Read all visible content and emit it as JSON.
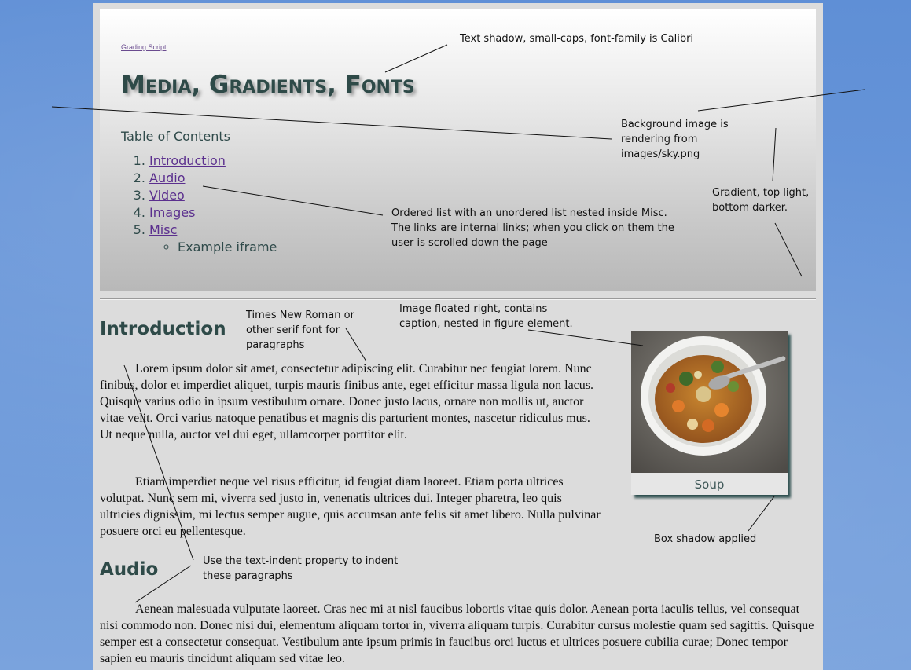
{
  "header": {
    "grading_link": "Grading Script",
    "title": "Media, Gradients, Fonts",
    "toc_title": "Table of Contents",
    "toc": [
      {
        "label": "Introduction"
      },
      {
        "label": "Audio"
      },
      {
        "label": "Video"
      },
      {
        "label": "Images"
      },
      {
        "label": "Misc"
      }
    ],
    "toc_sub": [
      "Example iframe"
    ]
  },
  "sections": {
    "intro": {
      "heading": "Introduction",
      "p1": "Lorem ipsum dolor sit amet, consectetur adipiscing elit. Curabitur nec feugiat lorem. Nunc finibus, dolor et imperdiet aliquet, turpis mauris finibus ante, eget efficitur massa ligula non lacus. Quisque varius odio in ipsum vestibulum ornare. Donec justo lacus, ornare non mollis ut, auctor vitae velit. Orci varius natoque penatibus et magnis dis parturient montes, nascetur ridiculus mus. Ut neque nulla, auctor vel dui eget, ullamcorper porttitor elit.",
      "p2": "Etiam imperdiet neque vel risus efficitur, id feugiat diam laoreet. Etiam porta ultrices volutpat. Nunc sem mi, viverra sed justo in, venenatis ultrices dui. Integer pharetra, leo quis ultricies dignissim, mi lectus semper augue, quis accumsan ante felis sit amet libero. Nulla pulvinar posuere orci eu pellentesque."
    },
    "audio": {
      "heading": "Audio",
      "p1": "Aenean malesuada vulputate laoreet. Cras nec mi at nisl faucibus lobortis vitae quis dolor. Aenean porta iaculis tellus, vel consequat nisi commodo non. Donec nisi dui, elementum aliquam tortor in, viverra aliquam turpis. Curabitur cursus molestie quam sed sagittis. Quisque semper est a consectetur consequat. Vestibulum ante ipsum primis in faucibus orci luctus et ultrices posuere cubilia curae; Donec tempor sapien eu mauris tincidunt aliquam sed vitae leo."
    }
  },
  "figure": {
    "caption": "Soup"
  },
  "annotations": {
    "text_shadow": "Text shadow, small-caps, font-family is Calibri",
    "bg_image": [
      "Background image is",
      "rendering from",
      "images/sky.png"
    ],
    "gradient": [
      "Gradient, top light,",
      "bottom darker."
    ],
    "ordered_list": [
      "Ordered list with an unordered list nested inside Misc.",
      "The links are internal links; when you click on them the",
      "user is scrolled down the page"
    ],
    "times": [
      "Times New Roman or",
      "other serif font for",
      "paragraphs"
    ],
    "image_float": [
      "Image floated right, contains",
      "caption, nested in figure element."
    ],
    "box_shadow": "Box shadow applied",
    "text_indent": [
      "Use the text-indent property to indent",
      "these paragraphs"
    ]
  }
}
